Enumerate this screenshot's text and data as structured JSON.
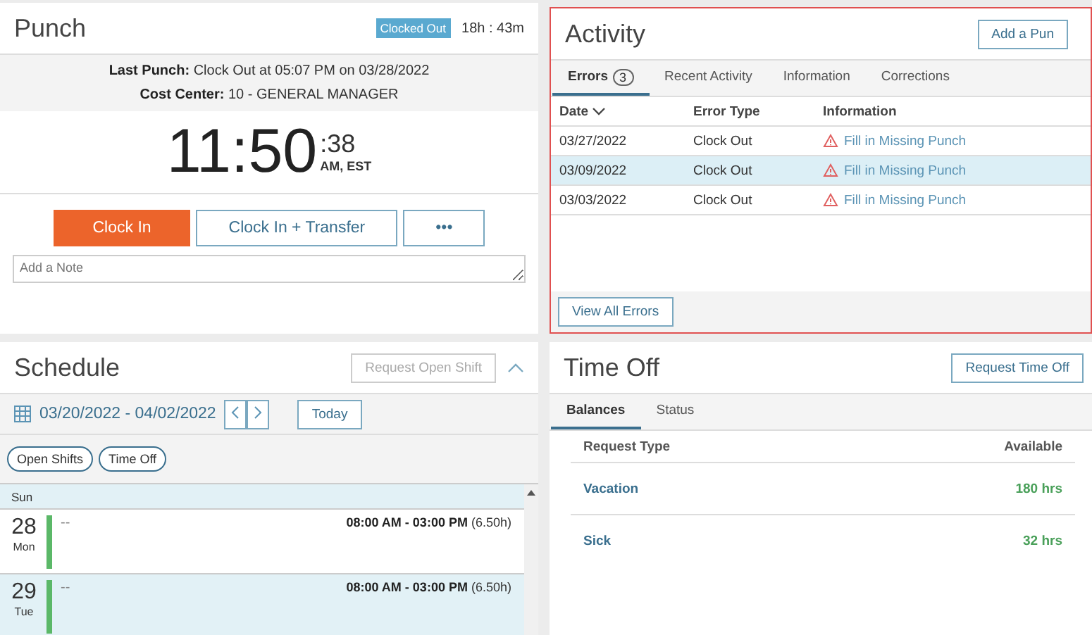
{
  "punch": {
    "title": "Punch",
    "status_badge": "Clocked Out",
    "elapsed": "18h : 43m",
    "last_punch_label": "Last Punch:",
    "last_punch": "Clock Out at 05:07 PM on 03/28/2022",
    "cost_center_label": "Cost Center:",
    "cost_center": "10 - GENERAL MANAGER",
    "time": "11:50",
    "seconds": ":38",
    "zone": "AM, EST",
    "buttons": [
      {
        "label": "Clock In",
        "kind": "primary"
      },
      {
        "label": "Clock In + Transfer",
        "kind": "outline"
      },
      {
        "label": "•••",
        "kind": "outline"
      }
    ],
    "note": {
      "placeholder": "Add a Note"
    }
  },
  "activity": {
    "title": "Activity",
    "button": "Add a Pun",
    "tabs": [
      {
        "label": "Errors",
        "count": "3",
        "selected": true
      },
      {
        "label": "Recent Activity",
        "selected": false
      },
      {
        "label": "Information",
        "selected": false
      },
      {
        "label": "Corrections",
        "selected": false
      }
    ],
    "columns": [
      "Date",
      "Error Type",
      "Information"
    ],
    "rows": [
      {
        "date": "03/27/2022",
        "type": "Clock Out",
        "info": "Fill in Missing Punch",
        "selected": false
      },
      {
        "date": "03/09/2022",
        "type": "Clock Out",
        "info": "Fill in Missing Punch",
        "selected": true
      },
      {
        "date": "03/03/2022",
        "type": "Clock Out",
        "info": "Fill in Missing Punch",
        "selected": false
      }
    ],
    "footer_button": "View All Errors"
  },
  "schedule": {
    "title": "Schedule",
    "request_button": "Request Open Shift",
    "range": "03/20/2022 - 04/02/2022",
    "today_button": "Today",
    "filters": [
      "Open Shifts",
      "Time Off"
    ],
    "partial_day": "Sun",
    "days": [
      {
        "date": "28",
        "weekday": "Mon",
        "note": "--",
        "hours": "08:00 AM - 03:00 PM",
        "duration": "(6.50h)",
        "selected": false
      },
      {
        "date": "29",
        "weekday": "Tue",
        "note": "--",
        "hours": "08:00 AM - 03:00 PM",
        "duration": "(6.50h)",
        "selected": true
      }
    ]
  },
  "time_off": {
    "title": "Time Off",
    "button": "Request Time Off",
    "tabs": [
      {
        "label": "Balances",
        "selected": true
      },
      {
        "label": "Status",
        "selected": false
      }
    ],
    "columns": [
      "Request Type",
      "Available"
    ],
    "rows": [
      {
        "type": "Vacation",
        "available": "180 hrs"
      },
      {
        "type": "Sick",
        "available": "32 hrs"
      }
    ]
  }
}
